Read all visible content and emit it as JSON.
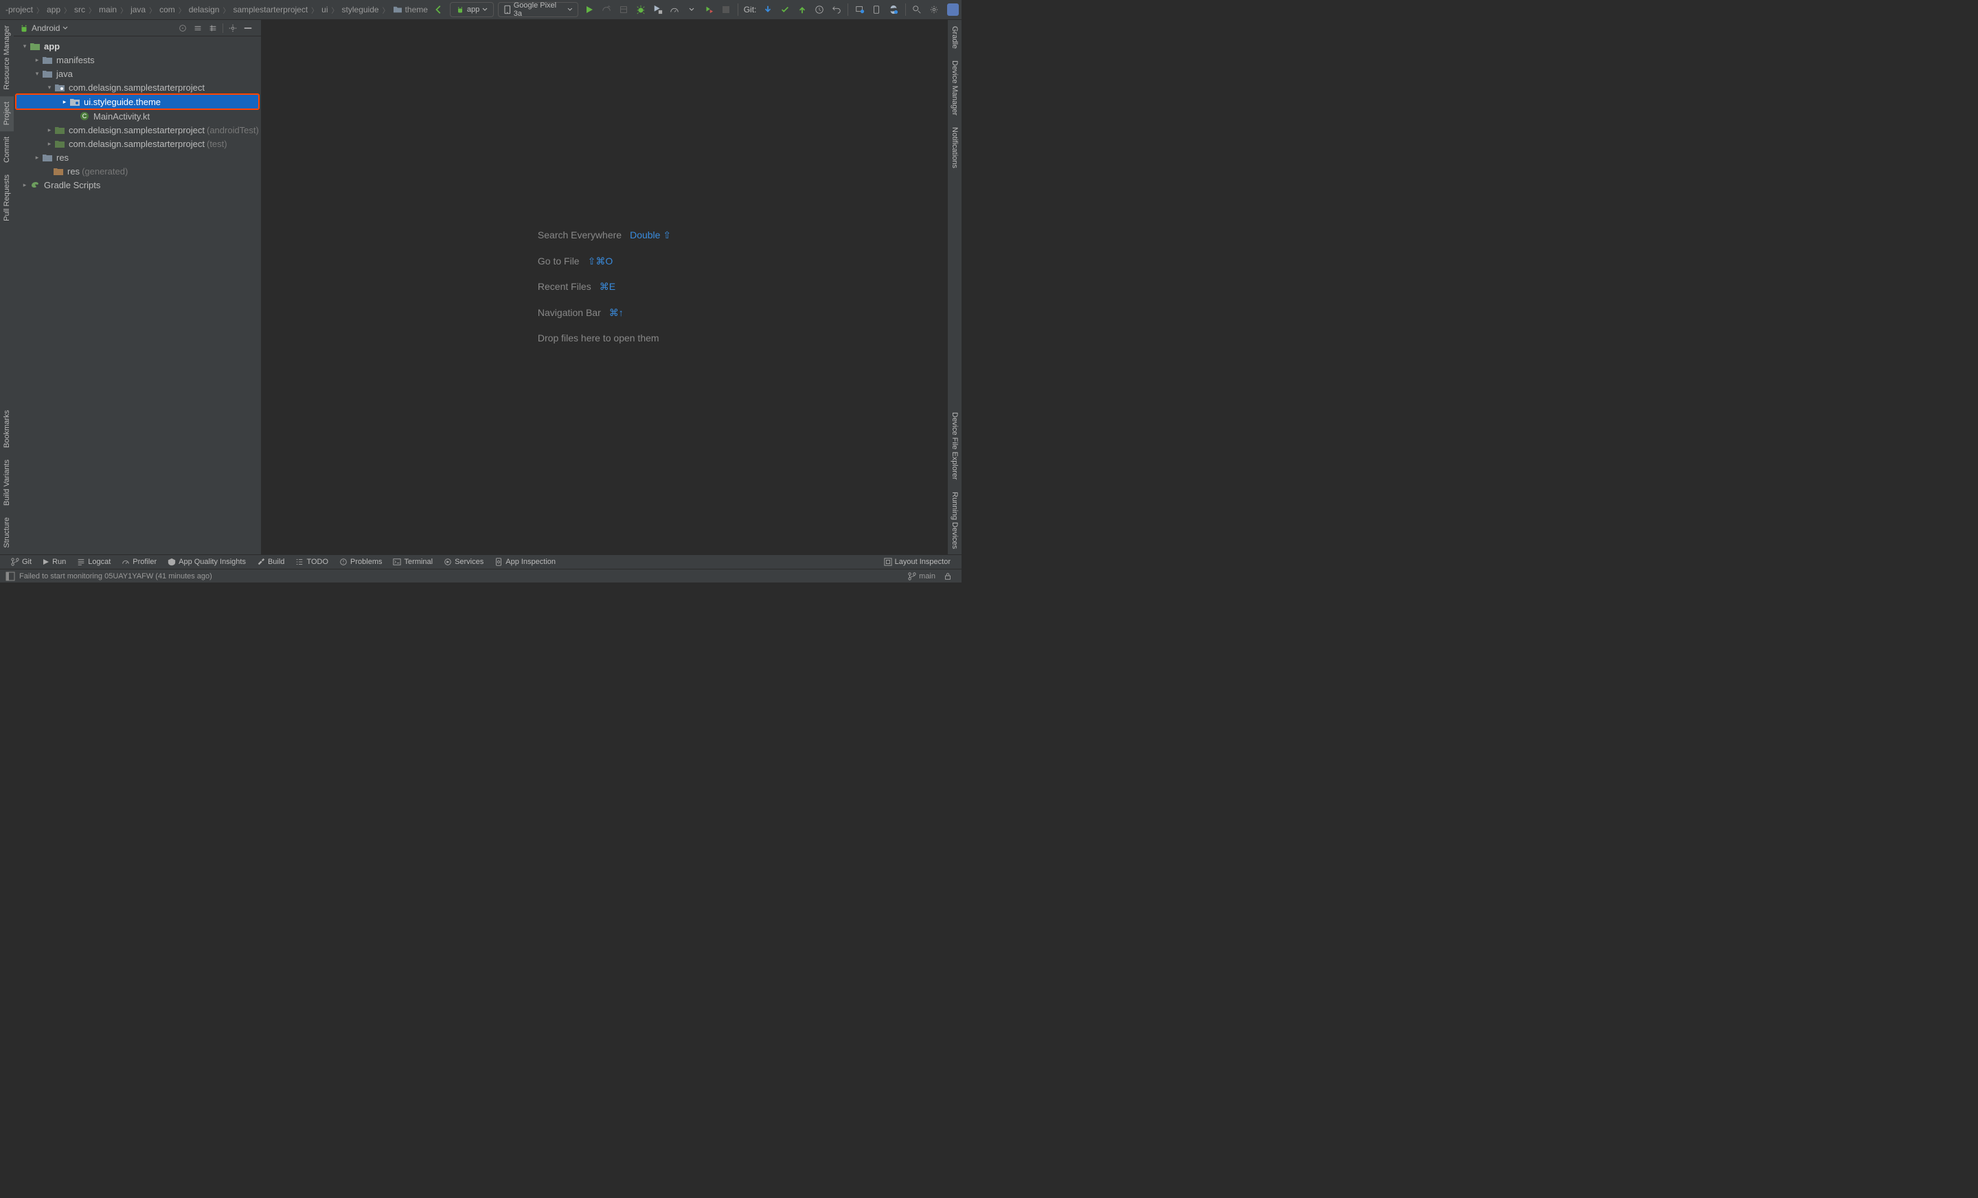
{
  "breadcrumb": [
    {
      "label": "-project"
    },
    {
      "label": "app"
    },
    {
      "label": "src"
    },
    {
      "label": "main"
    },
    {
      "label": "java"
    },
    {
      "label": "com"
    },
    {
      "label": "delasign"
    },
    {
      "label": "samplestarterproject"
    },
    {
      "label": "ui"
    },
    {
      "label": "styleguide"
    },
    {
      "label": "theme",
      "icon": "folder"
    }
  ],
  "run_config": {
    "label": "app"
  },
  "device_config": {
    "label": "Google Pixel 3a"
  },
  "git_label": "Git:",
  "project_panel": {
    "view_label": "Android"
  },
  "tree": {
    "app_bold": "app",
    "manifests": "manifests",
    "java": "java",
    "pkg_main": "com.delasign.samplestarterproject",
    "ui_theme": "ui.styleguide.theme",
    "main_activity": "MainActivity.kt",
    "pkg_androidtest": "com.delasign.samplestarterproject",
    "pkg_androidtest_suffix": "(androidTest)",
    "pkg_test": "com.delasign.samplestarterproject",
    "pkg_test_suffix": "(test)",
    "res": "res",
    "res_gen": "res",
    "res_gen_suffix": "(generated)",
    "gradle": "Gradle Scripts"
  },
  "placeholder": {
    "search_label": "Search Everywhere",
    "search_shortcut": "Double ⇧",
    "goto_label": "Go to File",
    "goto_shortcut": "⇧⌘O",
    "recent_label": "Recent Files",
    "recent_shortcut": "⌘E",
    "nav_label": "Navigation Bar",
    "nav_shortcut": "⌘↑",
    "drop_text": "Drop files here to open them"
  },
  "left_tabs": {
    "resource_manager": "Resource Manager",
    "project": "Project",
    "commit": "Commit",
    "pull_requests": "Pull Requests",
    "bookmarks": "Bookmarks",
    "build_variants": "Build Variants",
    "structure": "Structure"
  },
  "right_tabs": {
    "gradle": "Gradle",
    "device_manager": "Device Manager",
    "notifications": "Notifications",
    "device_file_explorer": "Device File Explorer",
    "running_devices": "Running Devices"
  },
  "bottom_tabs": {
    "git": "Git",
    "run": "Run",
    "logcat": "Logcat",
    "profiler": "Profiler",
    "aqi": "App Quality Insights",
    "build": "Build",
    "todo": "TODO",
    "problems": "Problems",
    "terminal": "Terminal",
    "services": "Services",
    "app_inspection": "App Inspection",
    "layout_inspector": "Layout Inspector"
  },
  "status": {
    "message": "Failed to start monitoring 05UAY1YAFW (41 minutes ago)",
    "branch": "main"
  }
}
